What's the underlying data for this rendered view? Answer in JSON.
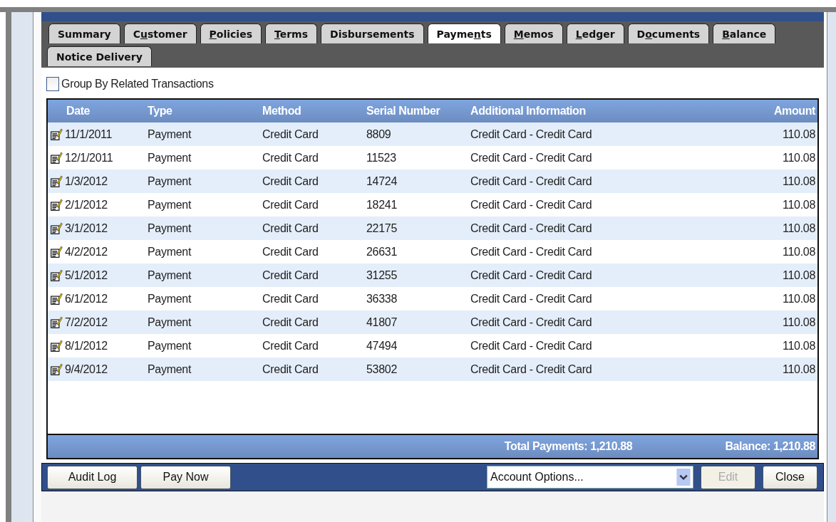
{
  "tabs": [
    {
      "label": "Summary",
      "selected": false
    },
    {
      "label": "C",
      "hotkey": "u",
      "rest": "stomer",
      "selected": false
    },
    {
      "hotkey": "P",
      "rest": "olicies",
      "selected": false
    },
    {
      "hotkey": "T",
      "rest": "erms",
      "selected": false
    },
    {
      "label": "Disbursements",
      "selected": false
    },
    {
      "label": "Payme",
      "hotkey": "n",
      "rest": "ts",
      "selected": true
    },
    {
      "hotkey": "M",
      "rest": "emos",
      "selected": false
    },
    {
      "hotkey": "L",
      "rest": "edger",
      "selected": false
    },
    {
      "label": "D",
      "hotkey": "o",
      "rest": "cuments",
      "selected": false
    },
    {
      "hotkey": "B",
      "rest": "alance",
      "selected": false
    },
    {
      "label": "Notice Delivery",
      "selected": false
    }
  ],
  "group_by": {
    "label": "Group By Related Transactions",
    "checked": false
  },
  "table": {
    "columns": [
      "Date",
      "Type",
      "Method",
      "Serial Number",
      "Additional Information",
      "Amount"
    ],
    "rows": [
      [
        "11/1/2011",
        "Payment",
        "Credit Card",
        "8809",
        "Credit Card - Credit Card",
        "110.08"
      ],
      [
        "12/1/2011",
        "Payment",
        "Credit Card",
        "11523",
        "Credit Card - Credit Card",
        "110.08"
      ],
      [
        "1/3/2012",
        "Payment",
        "Credit Card",
        "14724",
        "Credit Card - Credit Card",
        "110.08"
      ],
      [
        "2/1/2012",
        "Payment",
        "Credit Card",
        "18241",
        "Credit Card - Credit Card",
        "110.08"
      ],
      [
        "3/1/2012",
        "Payment",
        "Credit Card",
        "22175",
        "Credit Card - Credit Card",
        "110.08"
      ],
      [
        "4/2/2012",
        "Payment",
        "Credit Card",
        "26631",
        "Credit Card - Credit Card",
        "110.08"
      ],
      [
        "5/1/2012",
        "Payment",
        "Credit Card",
        "31255",
        "Credit Card - Credit Card",
        "110.08"
      ],
      [
        "6/1/2012",
        "Payment",
        "Credit Card",
        "36338",
        "Credit Card - Credit Card",
        "110.08"
      ],
      [
        "7/2/2012",
        "Payment",
        "Credit Card",
        "41807",
        "Credit Card - Credit Card",
        "110.08"
      ],
      [
        "8/1/2012",
        "Payment",
        "Credit Card",
        "47494",
        "Credit Card - Credit Card",
        "110.08"
      ],
      [
        "9/4/2012",
        "Payment",
        "Credit Card",
        "53802",
        "Credit Card - Credit Card",
        "110.08"
      ]
    ],
    "total": "Total Payments: 1,210.88",
    "balance": "Balance: 1,210.88"
  },
  "buttons_left": [
    {
      "label": "Audit Log",
      "disabled": false
    },
    {
      "label": "Pay Now",
      "disabled": false
    }
  ],
  "account_options": {
    "value": "Account Options..."
  },
  "buttons_right": [
    {
      "label": "Edit",
      "disabled": true
    },
    {
      "label": "Close",
      "disabled": false
    }
  ]
}
